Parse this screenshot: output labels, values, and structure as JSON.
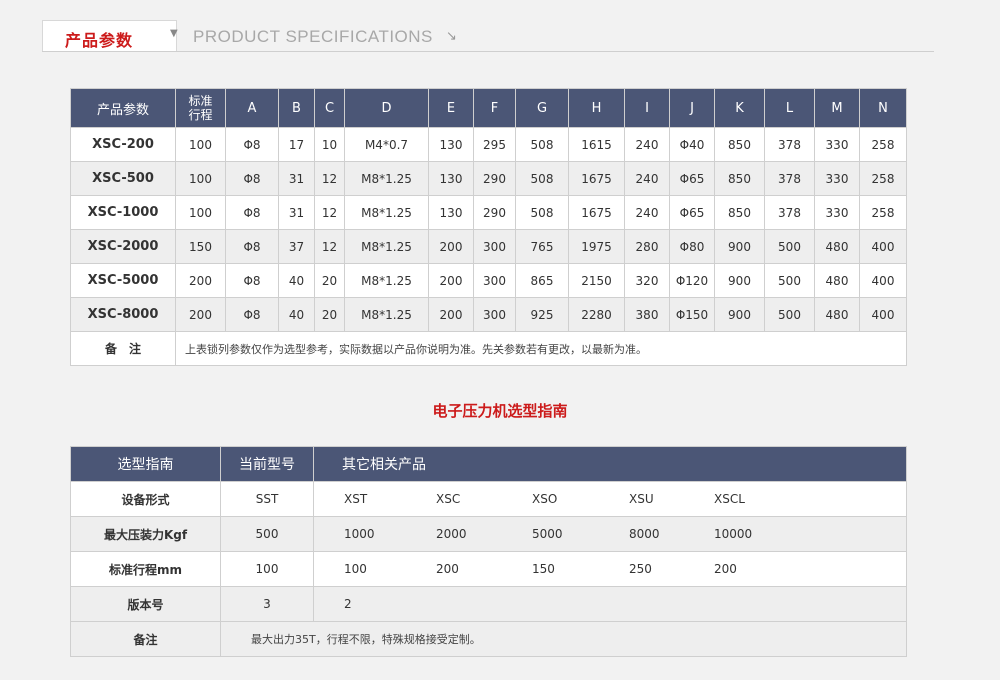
{
  "header": {
    "title": "产品参数",
    "subtitle": "PRODUCT SPECIFICATIONS"
  },
  "spec_table": {
    "headers": [
      "产品参数",
      "标准\n行程",
      "A",
      "B",
      "C",
      "D",
      "E",
      "F",
      "G",
      "H",
      "I",
      "J",
      "K",
      "L",
      "M",
      "N"
    ],
    "rows": [
      [
        "XSC-200",
        "100",
        "Φ8",
        "17",
        "10",
        "M4*0.7",
        "130",
        "295",
        "508",
        "1615",
        "240",
        "Φ40",
        "850",
        "378",
        "330",
        "258"
      ],
      [
        "XSC-500",
        "100",
        "Φ8",
        "31",
        "12",
        "M8*1.25",
        "130",
        "290",
        "508",
        "1675",
        "240",
        "Φ65",
        "850",
        "378",
        "330",
        "258"
      ],
      [
        "XSC-1000",
        "100",
        "Φ8",
        "31",
        "12",
        "M8*1.25",
        "130",
        "290",
        "508",
        "1675",
        "240",
        "Φ65",
        "850",
        "378",
        "330",
        "258"
      ],
      [
        "XSC-2000",
        "150",
        "Φ8",
        "37",
        "12",
        "M8*1.25",
        "200",
        "300",
        "765",
        "1975",
        "280",
        "Φ80",
        "900",
        "500",
        "480",
        "400"
      ],
      [
        "XSC-5000",
        "200",
        "Φ8",
        "40",
        "20",
        "M8*1.25",
        "200",
        "300",
        "865",
        "2150",
        "320",
        "Φ120",
        "900",
        "500",
        "480",
        "400"
      ],
      [
        "XSC-8000",
        "200",
        "Φ8",
        "40",
        "20",
        "M8*1.25",
        "200",
        "300",
        "925",
        "2280",
        "380",
        "Φ150",
        "900",
        "500",
        "480",
        "400"
      ]
    ],
    "note_label": "备注",
    "note_text": "上表锁列参数仅作为选型参考，实际数据以产品你说明为准。先关参数若有更改，以最新为准。"
  },
  "guide_title": "电子压力机选型指南",
  "guide_table": {
    "headers": [
      "选型指南",
      "当前型号",
      "其它相关产品"
    ],
    "rows": [
      {
        "label": "设备形式",
        "current": "SST",
        "others": [
          "XST",
          "XSC",
          "XSO",
          "XSU",
          "XSCL"
        ]
      },
      {
        "label": "最大压装力Kgf",
        "current": "500",
        "others": [
          "1000",
          "2000",
          "5000",
          "8000",
          "10000"
        ]
      },
      {
        "label": "标准行程mm",
        "current": "100",
        "others": [
          "100",
          "200",
          "150",
          "250",
          "200"
        ]
      },
      {
        "label": "版本号",
        "current": "3",
        "others": [
          "2"
        ]
      }
    ],
    "note_label": "备注",
    "note_text": "最大出力35T，行程不限，特殊规格接受定制。"
  }
}
